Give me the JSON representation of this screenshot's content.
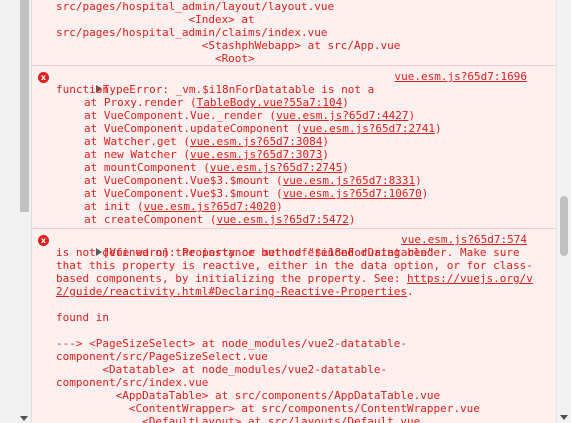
{
  "top_trace": [
    "src/pages/hospital_admin/layout/layout.vue",
    "                    <Index> at",
    "src/pages/hospital_admin/claims/index.vue",
    "                      <StashphWebapp> at src/App.vue",
    "                        <Root>"
  ],
  "error1": {
    "icon": "x",
    "title": "TypeError: _vm.$i18nForDatatable is not a",
    "title2": "function",
    "source": "vue.esm.js?65d7:1696",
    "frames": [
      {
        "prefix": "at Proxy.render (",
        "link": "TableBody.vue?55a7:104",
        "suffix": ")"
      },
      {
        "prefix": "at VueComponent.Vue._render (",
        "link": "vue.esm.js?65d7:4427",
        "suffix": ")"
      },
      {
        "prefix": "at VueComponent.updateComponent (",
        "link": "vue.esm.js?65d7:2741",
        "suffix": ")"
      },
      {
        "prefix": "at Watcher.get (",
        "link": "vue.esm.js?65d7:3084",
        "suffix": ")"
      },
      {
        "prefix": "at new Watcher (",
        "link": "vue.esm.js?65d7:3073",
        "suffix": ")"
      },
      {
        "prefix": "at mountComponent (",
        "link": "vue.esm.js?65d7:2745",
        "suffix": ")"
      },
      {
        "prefix": "at VueComponent.Vue$3.$mount (",
        "link": "vue.esm.js?65d7:8331",
        "suffix": ")"
      },
      {
        "prefix": "at VueComponent.Vue$3.$mount (",
        "link": "vue.esm.js?65d7:10670",
        "suffix": ")"
      },
      {
        "prefix": "at init (",
        "link": "vue.esm.js?65d7:4020",
        "suffix": ")"
      },
      {
        "prefix": "at createComponent (",
        "link": "vue.esm.js?65d7:5472",
        "suffix": ")"
      }
    ]
  },
  "error2": {
    "icon": "x",
    "title": "[Vue warn]: Property or method \"$i18nForDatatable\"",
    "source": "vue.esm.js?65d7:574",
    "body_lines": [
      "is not defined on the instance but referenced during render. Make sure",
      "that this property is reactive, either in the data option, or for class-"
    ],
    "body_last_prefix": "based components, by initializing the property. See: ",
    "doc_link_1": "https://vuejs.org/v",
    "doc_link_2": "2/guide/reactivity.html#Declaring-Reactive-Properties",
    "doc_link_suffix": ".",
    "found_in": "found in",
    "trace": [
      "---> <PageSizeSelect> at node_modules/vue2-datatable-",
      "component/src/PageSizeSelect.vue",
      "       <Datatable> at node_modules/vue2-datatable-",
      "component/src/index.vue",
      "         <AppDataTable> at src/components/AppDataTable.vue",
      "           <ContentWrapper> at src/components/ContentWrapper.vue",
      "             <DefaultLayout> at src/layouts/Default.vue"
    ]
  }
}
